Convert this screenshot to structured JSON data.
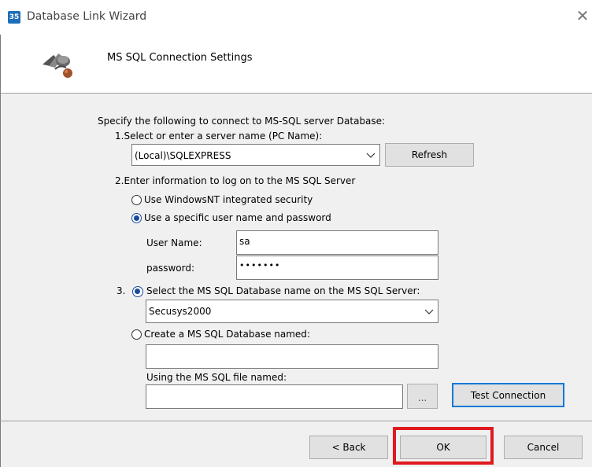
{
  "window": {
    "title": "Database Link Wizard",
    "app_icon_text": "35",
    "close_glyph": "✕"
  },
  "header": {
    "title": "MS SQL Connection Settings",
    "icon": "database-connect-icon"
  },
  "content": {
    "intro": "Specify the following to connect to MS-SQL server Database:",
    "step1_label": "1.Select or enter a server name (PC Name):",
    "server_name_value": "(Local)\\SQLEXPRESS",
    "refresh_label": "Refresh",
    "step2_label": "2.Enter information to log on to the MS SQL Server",
    "radio_windows_nt": "Use WindowsNT integrated security",
    "radio_specific_user": "Use a specific user name and password",
    "username_label": "User Name:",
    "username_value": "sa",
    "password_label": "password:",
    "password_value": "•••••••",
    "step3_number": "3.",
    "radio_select_db": "Select the MS SQL Database name on the MS SQL Server:",
    "database_value": "Secusys2000",
    "radio_create_db": "Create a MS SQL Database named:",
    "create_db_value": "",
    "file_label": "Using the MS SQL file named:",
    "file_value": "",
    "browse_label": "...",
    "test_connection_label": "Test Connection"
  },
  "footer": {
    "back_label": "< Back",
    "ok_label": "OK",
    "cancel_label": "Cancel"
  },
  "colors": {
    "highlight": "#e0191e",
    "accent": "#0078d7"
  }
}
